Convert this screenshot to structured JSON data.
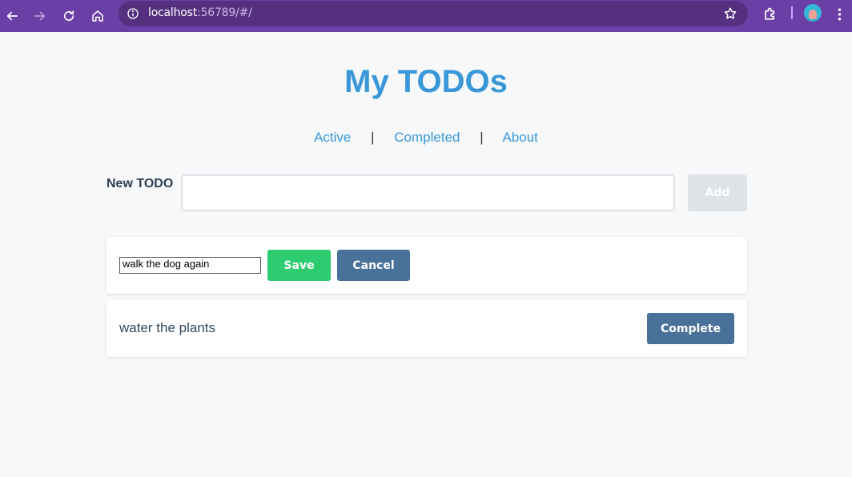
{
  "browser": {
    "url_host": "localhost",
    "url_path": ":56789/#/"
  },
  "page": {
    "title": "My TODOs",
    "nav": {
      "active": "Active",
      "completed": "Completed",
      "about": "About",
      "separator": "|"
    },
    "new_todo": {
      "label": "New TODO",
      "value": "",
      "add_label": "Add"
    },
    "todos": [
      {
        "editing": true,
        "value": "walk the dog again",
        "save_label": "Save",
        "cancel_label": "Cancel"
      },
      {
        "editing": false,
        "text": "water the plants",
        "complete_label": "Complete"
      }
    ]
  },
  "colors": {
    "toolbar": "#6b3fa5",
    "title": "#3a98d8",
    "save": "#2ecc71",
    "button_blue": "#4a7199"
  }
}
